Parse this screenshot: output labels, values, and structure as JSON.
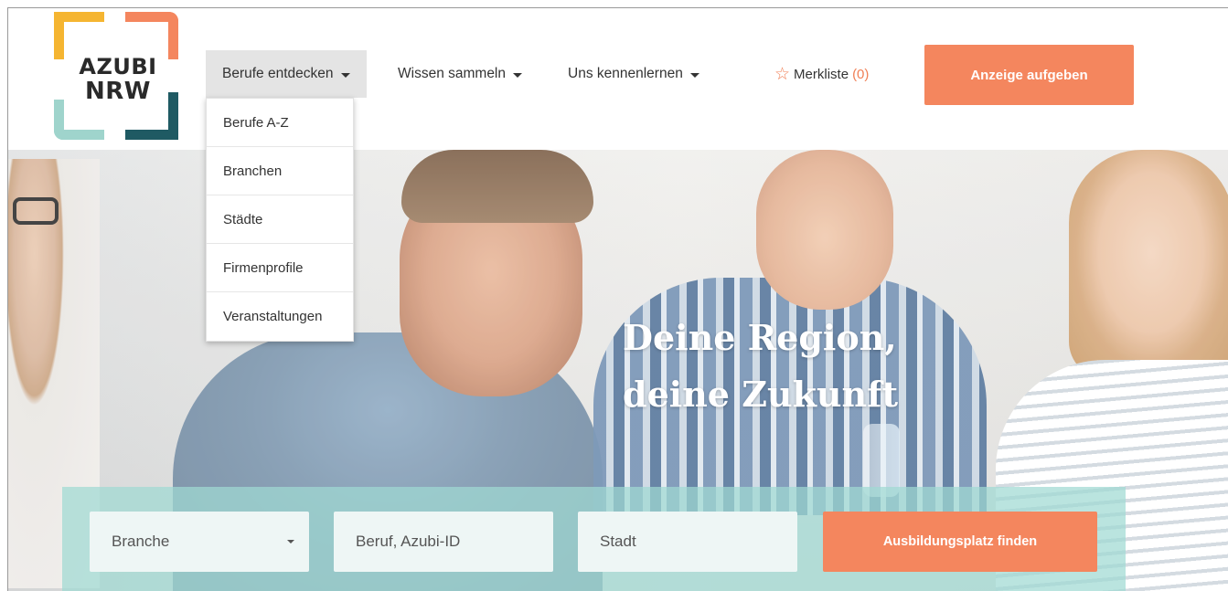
{
  "logo": {
    "line1": "AZUBI",
    "line2": "NRW",
    "colors": {
      "yellow": "#f5b531",
      "orange": "#f4865e",
      "teal": "#9fd4cc",
      "dark": "#1f5a63"
    }
  },
  "nav": {
    "items": [
      {
        "label": "Berufe entdecken",
        "active": true
      },
      {
        "label": "Wissen sammeln",
        "active": false
      },
      {
        "label": "Uns kennenlernen",
        "active": false
      }
    ],
    "merkliste": {
      "label": "Merkliste",
      "count": "(0)",
      "icon": "star-icon"
    },
    "cta_label": "Anzeige aufgeben"
  },
  "dropdown": {
    "items": [
      "Berufe A-Z",
      "Branchen",
      "Städte",
      "Firmenprofile",
      "Veranstaltungen"
    ]
  },
  "hero": {
    "headline_line1": "Deine Region,",
    "headline_line2": "deine Zukunft"
  },
  "search": {
    "branche": {
      "value": "Branche",
      "icon": "chevron-down-icon"
    },
    "beruf": {
      "placeholder": "Beruf, Azubi-ID"
    },
    "stadt": {
      "placeholder": "Stadt"
    },
    "submit_label": "Ausbildungsplatz finden"
  },
  "colors": {
    "accent": "#f4865e",
    "panel": "#a0dad2",
    "dropdown_active": "#e4e4e4"
  }
}
